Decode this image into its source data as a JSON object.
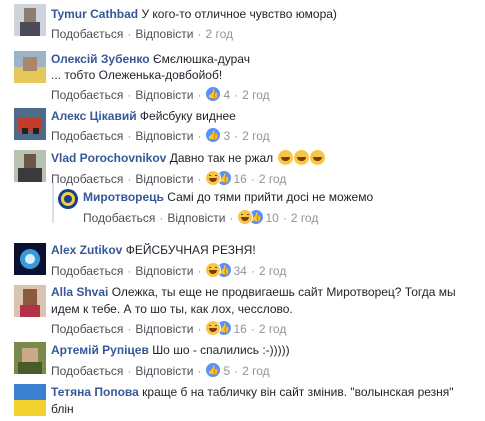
{
  "comments": [
    {
      "author": "Tymur Cathbad",
      "text": "У кого-то отличное чувство юмора)",
      "like": "Подобається",
      "reply": "Відповісти",
      "reaction_count": "",
      "time": "2 год"
    },
    {
      "author": "Олексій Зубенко",
      "text": "Ємєлюшка-дурач",
      "text2": "... тобто Олеженька-довбойоб!",
      "like": "Подобається",
      "reply": "Відповісти",
      "reaction_count": "4",
      "time": "2 год"
    },
    {
      "author": "Алекс Цікавий",
      "text": "Фейсбуку виднее",
      "like": "Подобається",
      "reply": "Відповісти",
      "reaction_count": "3",
      "time": "2 год"
    },
    {
      "author": "Vlad Porochovnikov",
      "text": "Давно так не ржал",
      "like": "Подобається",
      "reply": "Відповісти",
      "reaction_count": "16",
      "time": "2 год"
    },
    {
      "author": "Миротворець",
      "text": "Самі до тями прийти досі не можемо",
      "like": "Подобається",
      "reply": "Відповісти",
      "reaction_count": "10",
      "time": "2 год"
    },
    {
      "author": "Alex Zutikov",
      "text": "ФЕЙСБУЧНАЯ РЕЗНЯ!",
      "like": "Подобається",
      "reply": "Відповісти",
      "reaction_count": "34",
      "time": "2 год"
    },
    {
      "author": "Alla Shvai",
      "text": "Олежка, ты еще не продвигаешь сайт Миротворец? Тогда мы",
      "text2": "идем к тебе. А то шо ты, как лох, чесслово.",
      "like": "Подобається",
      "reply": "Відповісти",
      "reaction_count": "16",
      "time": "2 год"
    },
    {
      "author": "Артемій Рупіцев",
      "text": "Шо шо - спалились :-)))))",
      "like": "Подобається",
      "reply": "Відповісти",
      "reaction_count": "5",
      "time": "2 год"
    },
    {
      "author": "Тетяна Попова",
      "text": "краще б на табличку він сайт змінив. \"волынская резня\"",
      "text2": "блін"
    }
  ],
  "colors": {
    "author": "#365899",
    "meta": "#90949c",
    "link": "#4b4f56",
    "like_blue": "#5890ff",
    "haha_yellow": "#f7c649"
  }
}
